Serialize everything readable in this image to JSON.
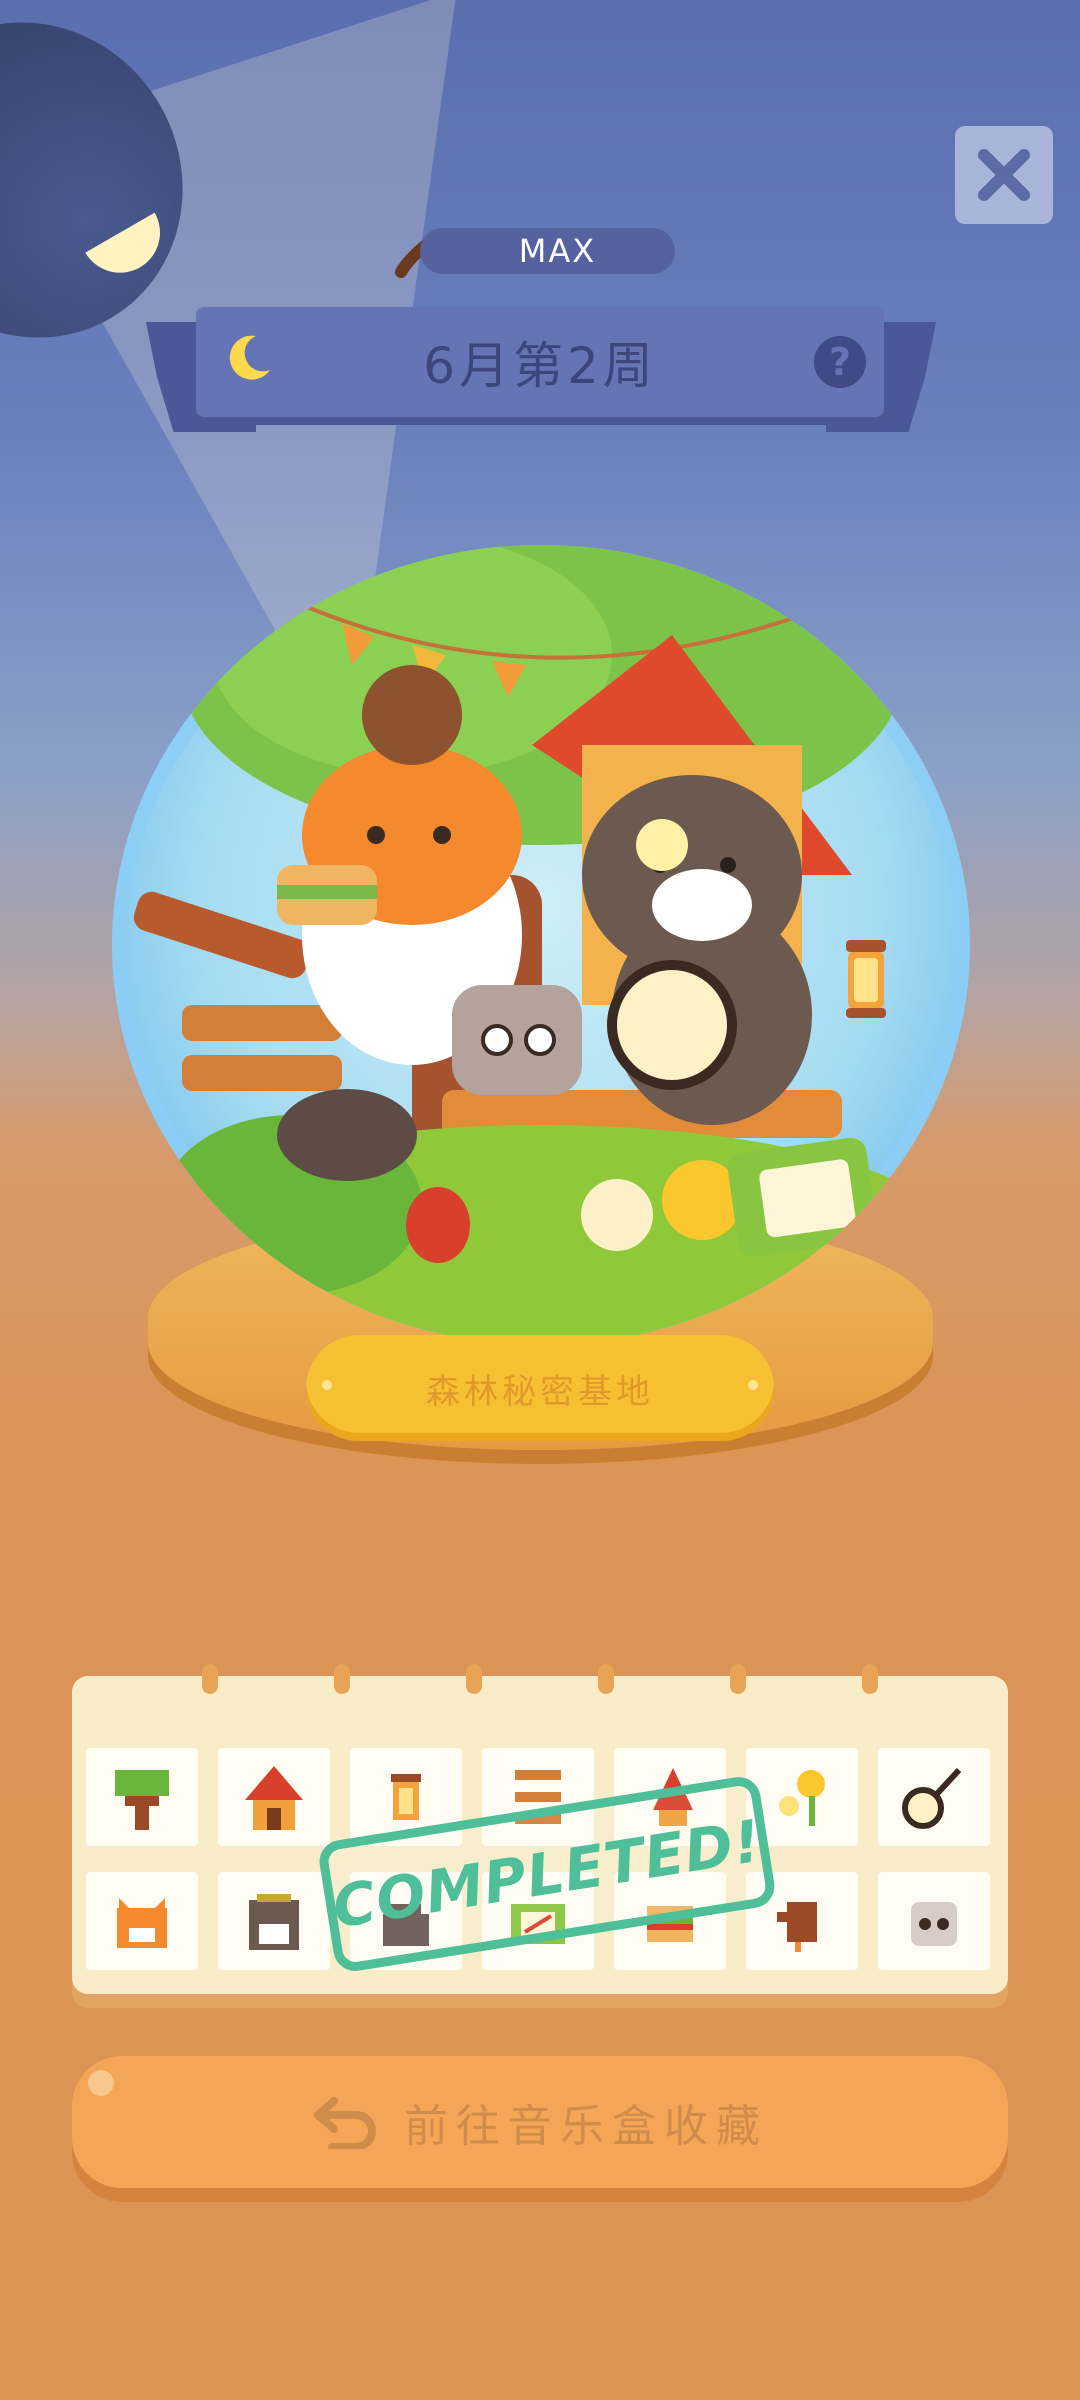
{
  "header": {
    "energy_label": "MAX",
    "week_title": "6月第2周",
    "close_icon": "close-icon",
    "help_glyph": "?"
  },
  "scene": {
    "plaque_title": "森林秘密基地"
  },
  "collection": {
    "stamp_text": "COMPLETED!",
    "rows": [
      [
        "tree-sticker-icon",
        "house-sticker-icon",
        "lantern-sticker-icon",
        "ladder-sticker-icon",
        "roof-sticker-icon",
        "flower-sticker-icon",
        "banjo-sticker-icon"
      ],
      [
        "orange-cat-sticker-icon",
        "tabby-cat-sticker-icon",
        "stone-sticker-icon",
        "box-sticker-icon",
        "sandwich-sticker-icon",
        "bird-sticker-icon",
        "rock-face-sticker-icon"
      ]
    ]
  },
  "footer": {
    "go_button_label": "前往音乐盒收藏"
  },
  "colors": {
    "sky_top": "#5b6fb0",
    "floor": "#dc9453",
    "banner": "#6474b4",
    "stamp": "#4fbf99",
    "button": "#f4a657"
  }
}
